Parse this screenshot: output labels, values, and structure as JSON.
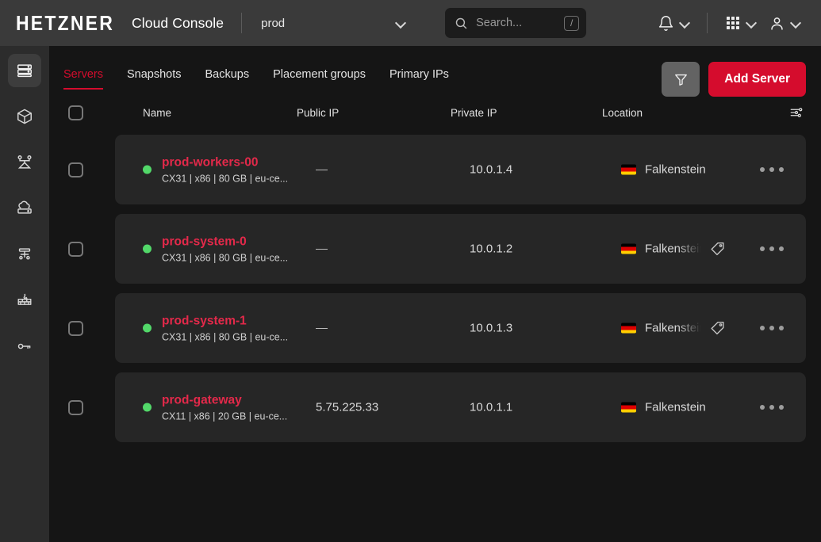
{
  "header": {
    "logo": "HETZNER",
    "title": "Cloud Console",
    "project": "prod",
    "search_placeholder": "Search...",
    "search_shortcut": "/",
    "icons": {
      "search": "search-icon",
      "bell": "bell-icon",
      "apps": "grid-apps-icon",
      "account": "user-account-icon",
      "chevron": "chevron-down-icon"
    }
  },
  "sidebar": {
    "items": [
      {
        "name": "servers",
        "icon": "server-icon",
        "active": true
      },
      {
        "name": "volumes",
        "icon": "cube-icon",
        "active": false
      },
      {
        "name": "load-balancers",
        "icon": "load-balancer-icon",
        "active": false
      },
      {
        "name": "networks",
        "icon": "cloud-server-icon",
        "active": false
      },
      {
        "name": "floating-ips",
        "icon": "floating-ip-icon",
        "active": false
      },
      {
        "name": "firewalls",
        "icon": "firewall-icon",
        "active": false
      },
      {
        "name": "ssh-keys",
        "icon": "key-icon",
        "active": false
      }
    ]
  },
  "tabs": [
    {
      "label": "Servers",
      "active": true
    },
    {
      "label": "Snapshots",
      "active": false
    },
    {
      "label": "Backups",
      "active": false
    },
    {
      "label": "Placement groups",
      "active": false
    },
    {
      "label": "Primary IPs",
      "active": false
    }
  ],
  "actions": {
    "filter_label": "",
    "filter_icon": "filter-funnel-icon",
    "add_server_label": "Add Server"
  },
  "table": {
    "columns": [
      "Name",
      "Public IP",
      "Private IP",
      "Location"
    ],
    "settings_icon": "column-settings-icon",
    "rows": [
      {
        "name": "prod-workers-00",
        "spec": "CX31 | x86 | 80 GB | eu-ce...",
        "public_ip": "—",
        "private_ip": "10.0.1.4",
        "location": "Falkenstein",
        "status": "running",
        "has_tag_icon": false,
        "location_truncated": false
      },
      {
        "name": "prod-system-0",
        "spec": "CX31 | x86 | 80 GB | eu-ce...",
        "public_ip": "—",
        "private_ip": "10.0.1.2",
        "location": "Falkenstein",
        "status": "running",
        "has_tag_icon": true,
        "location_truncated": true
      },
      {
        "name": "prod-system-1",
        "spec": "CX31 | x86 | 80 GB | eu-ce...",
        "public_ip": "—",
        "private_ip": "10.0.1.3",
        "location": "Falkenstein",
        "status": "running",
        "has_tag_icon": true,
        "location_truncated": true
      },
      {
        "name": "prod-gateway",
        "spec": "CX11 | x86 | 20 GB | eu-ce...",
        "public_ip": "5.75.225.33",
        "private_ip": "10.0.1.1",
        "location": "Falkenstein",
        "status": "running",
        "has_tag_icon": false,
        "location_truncated": false
      }
    ]
  },
  "colors": {
    "accent": "#d50c2d",
    "name_link": "#e3294a",
    "status_running": "#52d869",
    "topbar_bg": "#3a3a3a",
    "sidebar_bg": "#2c2c2c",
    "page_bg": "#151515",
    "row_bg": "#262626"
  }
}
